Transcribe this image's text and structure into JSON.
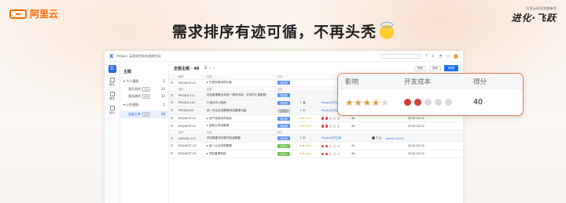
{
  "brand": {
    "name": "阿里云"
  },
  "event": {
    "small": "阿里云研发效能峰会",
    "big": "进化·飞跃"
  },
  "headline": "需求排序有迹可循，不再头秃",
  "app": {
    "product": "Projex",
    "breadcrumb": "Projex / 云效项目协作规划空间",
    "rail": [
      {
        "label": "概览"
      },
      {
        "label": "需求"
      },
      {
        "label": "迭代"
      }
    ],
    "sidebar": {
      "title": "主题",
      "personal": {
        "label": "个人视图",
        "count": "1"
      },
      "personal_items": [
        {
          "label": "我负责的",
          "tag": "系统",
          "count": "20"
        },
        {
          "label": "我创建的",
          "tag": "系统",
          "count": "10"
        }
      ],
      "public": {
        "label": "公共视图",
        "count": "1"
      },
      "active": {
        "label": "全部工单",
        "tag": "系统",
        "count": "48"
      }
    },
    "main": {
      "title": "全部主题 · 48",
      "filter_label": "筛选",
      "sort_label": "排序",
      "new_label": "新建"
    },
    "columns": {
      "id": "编号",
      "title": "标题",
      "status": "状态"
    },
    "rows": [
      {
        "id": "REQUEST-01",
        "title": "打造完美协同方案",
        "status": "待处理",
        "st": "blue",
        "kind": "main"
      },
      {
        "id": "PROJEX-112",
        "title": "项目集需要支持统一需求机制，并按时汇报数据",
        "status": "待处理",
        "st": "blue",
        "kind": "sub"
      },
      {
        "id": "PROJEX-102",
        "title": "打造协作小程序",
        "status": "待处理",
        "st": "blue",
        "kind": "sub",
        "priority": "高",
        "space": "Projex交付空间",
        "owner": "宁山",
        "sprint": "sprint-22Y24"
      },
      {
        "id": "PROJEX-80",
        "title": "统一的业务洞察需求池管理功能",
        "status": "已完成",
        "st": "gray",
        "kind": "sub",
        "priority": "中",
        "space": "Projex交付空间",
        "owner": "宁山",
        "sprint": "sprint-22Y24"
      },
      {
        "id": "REQUEST-03",
        "title": "资产线索协同系统",
        "status": "待处理",
        "st": "blue",
        "kind": "main",
        "stars": 4,
        "cost": 3,
        "score": "40",
        "date": "2020-02-02"
      },
      {
        "id": "REQUEST-01",
        "title": "智能云项目管理",
        "status": "待处理",
        "st": "blue",
        "kind": "main",
        "stars": 4,
        "cost": 3,
        "score": "40",
        "date": "2020-02-02"
      },
      {
        "id": "DESIGN-113",
        "title": "项目集要求关联项目级需要",
        "status": "待处理",
        "st": "blue",
        "kind": "sub",
        "priority": "中",
        "space": "Projex交付空间",
        "owner": "宁山",
        "sprint": "sprint-22Y24"
      },
      {
        "id": "REQUEST-13",
        "title": "统一企业研发管理",
        "status": "开发中",
        "st": "green",
        "kind": "main",
        "stars": 4,
        "cost": 3,
        "score": "40",
        "date": "2020-02-02"
      },
      {
        "id": "REQUEST-03",
        "title": "项目管理系统",
        "status": "开发中",
        "st": "green",
        "kind": "main",
        "stars": 4,
        "cost": 3,
        "score": "40",
        "date": "2020-02-02"
      }
    ]
  },
  "zoom": {
    "headers": {
      "impact": "影响",
      "cost": "开发成本",
      "score": "得分"
    },
    "impact_stars": 4,
    "impact_max": 5,
    "cost_filled": 2,
    "cost_max": 5,
    "score": "40"
  },
  "colors": {
    "accent": "#ff6a00",
    "primary": "#1b6ef3",
    "callout_border": "#e47a52"
  }
}
